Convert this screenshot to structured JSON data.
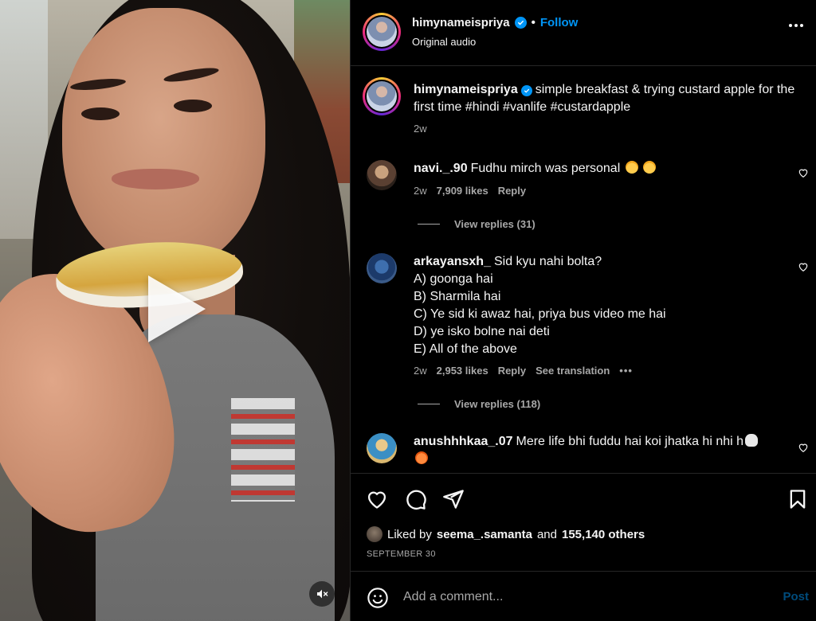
{
  "post": {
    "username": "himynameispriya",
    "follow_label": "Follow",
    "separator": "•",
    "audio": "Original audio"
  },
  "caption": {
    "username": "himynameispriya",
    "text": "simple breakfast & trying custard apple for the first time #hindi #vanlife #custardapple",
    "time": "2w"
  },
  "comments": [
    {
      "username": "navi._.90",
      "text": "Fudhu mirch was personal",
      "emojis": [
        "face-with-tears-of-joy",
        "face-with-tears-of-joy"
      ],
      "time": "2w",
      "likes": "7,909 likes",
      "reply_label": "Reply",
      "view_replies": "View replies (31)"
    },
    {
      "username": "arkayansxh_",
      "lines": [
        "Sid kyu nahi bolta?",
        "A) goonga hai",
        "B) Sharmila hai",
        "C) Ye sid ki awaz hai, priya bus video me hai",
        "D) ye isko bolne nai deti",
        "E) All of the above"
      ],
      "time": "2w",
      "likes": "2,953 likes",
      "reply_label": "Reply",
      "translation_label": "See translation",
      "more_label": "•••",
      "view_replies": "View replies (118)"
    },
    {
      "username": "anushhhkaa_.07",
      "text": "Mere life bhi fuddu hai koi jhatka hi nhi h",
      "emojis": [
        "skull",
        "hot-face"
      ]
    }
  ],
  "likes": {
    "prefix": "Liked by",
    "user": "seema_.samanta",
    "middle": "and",
    "count": "155,140 others"
  },
  "date": "SEPTEMBER 30",
  "composer": {
    "placeholder": "Add a comment...",
    "post_label": "Post"
  },
  "colors": {
    "accent": "#0095f6",
    "background": "#000000",
    "secondary_text": "#a8a8a8",
    "divider": "#262626"
  },
  "icons": [
    "play-icon",
    "mute-icon",
    "verified-icon",
    "more-options-icon",
    "heart-icon",
    "comment-icon",
    "share-icon",
    "bookmark-icon",
    "emoji-icon"
  ]
}
